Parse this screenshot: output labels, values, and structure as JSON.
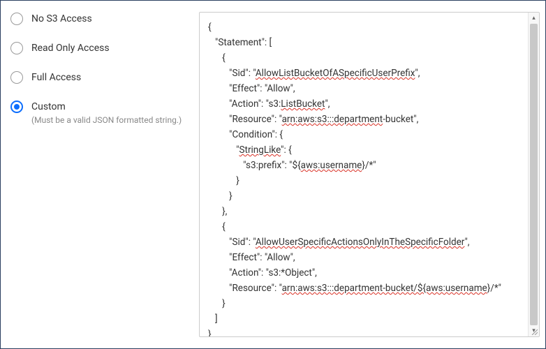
{
  "sidebar": {
    "options": [
      {
        "label": "No S3 Access",
        "hint": "",
        "selected": false
      },
      {
        "label": "Read Only Access",
        "hint": "",
        "selected": false
      },
      {
        "label": "Full Access",
        "hint": "",
        "selected": false
      },
      {
        "label": "Custom",
        "hint": "(Must be a valid JSON formatted string.)",
        "selected": true
      }
    ]
  },
  "code": {
    "lines": [
      {
        "indent": 0,
        "segments": [
          {
            "t": "{"
          }
        ]
      },
      {
        "indent": 1,
        "segments": [
          {
            "t": "\"Statement\": ["
          }
        ]
      },
      {
        "indent": 2,
        "segments": [
          {
            "t": "{"
          }
        ]
      },
      {
        "indent": 3,
        "segments": [
          {
            "t": "\"Sid\": \""
          },
          {
            "t": "AllowListBucketOfASpecificUserPrefix",
            "err": true
          },
          {
            "t": "\","
          }
        ]
      },
      {
        "indent": 3,
        "segments": [
          {
            "t": "\"Effect\": \"Allow\","
          }
        ]
      },
      {
        "indent": 3,
        "segments": [
          {
            "t": "\"Action\": \"s3:"
          },
          {
            "t": "ListBucket",
            "err": true
          },
          {
            "t": "\","
          }
        ]
      },
      {
        "indent": 3,
        "segments": [
          {
            "t": "\"Resource\": \""
          },
          {
            "t": "arn:aws:s3:::department",
            "err": true
          },
          {
            "t": "-bucket\","
          }
        ]
      },
      {
        "indent": 3,
        "segments": [
          {
            "t": "\"Condition\": {"
          }
        ]
      },
      {
        "indent": 4,
        "segments": [
          {
            "t": "\""
          },
          {
            "t": "StringLike",
            "err": true
          },
          {
            "t": "\": {"
          }
        ]
      },
      {
        "indent": 5,
        "segments": [
          {
            "t": "\"s3:prefix\": \"${"
          },
          {
            "t": "aws:username",
            "err": true
          },
          {
            "t": "}/*\""
          }
        ]
      },
      {
        "indent": 4,
        "segments": [
          {
            "t": "}"
          }
        ]
      },
      {
        "indent": 3,
        "segments": [
          {
            "t": "}"
          }
        ]
      },
      {
        "indent": 2,
        "segments": [
          {
            "t": "},"
          }
        ]
      },
      {
        "indent": 2,
        "segments": [
          {
            "t": "{"
          }
        ]
      },
      {
        "indent": 3,
        "segments": [
          {
            "t": "\"Sid\": \""
          },
          {
            "t": "AllowUserSpecificActionsOnlyInTheSpecificFolder",
            "err": true
          },
          {
            "t": "\","
          }
        ]
      },
      {
        "indent": 3,
        "segments": [
          {
            "t": "\"Effect\": \"Allow\","
          }
        ]
      },
      {
        "indent": 3,
        "segments": [
          {
            "t": "\"Action\": \"s3:*Object\","
          }
        ]
      },
      {
        "indent": 3,
        "segments": [
          {
            "t": "\"Resource\": \""
          },
          {
            "t": "arn:aws:s3:::department-bucket/${aws:username",
            "err": true
          },
          {
            "t": "}/*\""
          }
        ]
      },
      {
        "indent": 2,
        "segments": [
          {
            "t": "}"
          }
        ]
      },
      {
        "indent": 1,
        "segments": [
          {
            "t": "]"
          }
        ]
      },
      {
        "indent": 0,
        "segments": [
          {
            "t": "}"
          }
        ]
      }
    ]
  },
  "scrollbar": {
    "up_glyph": "▴",
    "down_glyph": "▾"
  }
}
